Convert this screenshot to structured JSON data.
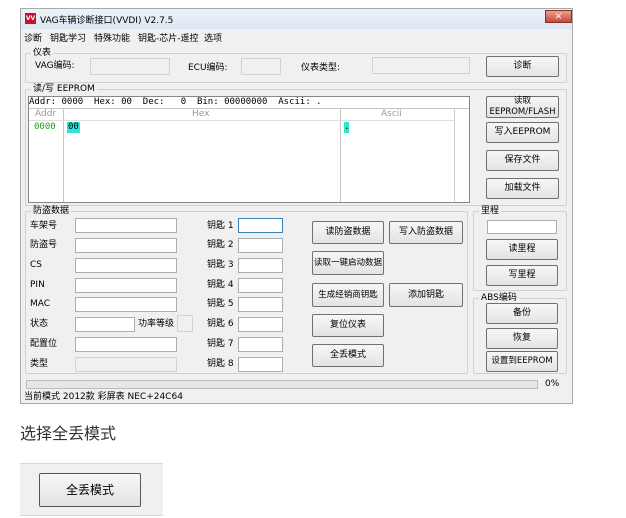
{
  "window": {
    "title": "VAG车辆诊断接口(VVDI)  V2.7.5",
    "logo_text": "VV",
    "close_glyph": "×"
  },
  "menu": [
    "诊断",
    "钥匙学习",
    "特殊功能",
    "钥匙-芯片-遥控",
    "选项"
  ],
  "instrument": {
    "group_label": "仪表",
    "vag_label": "VAG编码:",
    "ecu_label": "ECU编码:",
    "type_label": "仪表类型:",
    "diagnose_button": "诊断"
  },
  "eeprom": {
    "group_label": "读/写 EEPROM",
    "header_line": "Addr: 0000  Hex: 00  Dec:   0  Bin: 00000000  Ascii: .",
    "col_addr": "Addr",
    "col_hex": "Hex",
    "col_ascii": "Ascii",
    "row_addr": "0000",
    "row_hex": "00",
    "row_ascii": ".",
    "read_button": "读取\nEEPROM/FLASH",
    "write_button": "写入EEPROM",
    "save_button": "保存文件",
    "load_button": "加载文件"
  },
  "immo": {
    "group_label": "防盗数据",
    "fields": [
      "车架号",
      "防盗号",
      "CS",
      "PIN",
      "MAC",
      "状态",
      "配置位",
      "类型"
    ],
    "power_label": "功率等级",
    "keys": [
      "钥匙 1",
      "钥匙 2",
      "钥匙 3",
      "钥匙 4",
      "钥匙 5",
      "钥匙 6",
      "钥匙 7",
      "钥匙 8"
    ],
    "read_immo": "读防盗数据",
    "write_immo": "写入防盗数据",
    "read_start": "读取一键启动数据",
    "gen_dealer_key": "生成经销商钥匙",
    "add_key": "添加钥匙",
    "reset_cluster": "复位仪表",
    "all_keys_lost": "全丢模式"
  },
  "mileage": {
    "group_label": "里程",
    "read_button": "读里程",
    "write_button": "写里程"
  },
  "abs": {
    "group_label": "ABS编码",
    "backup_button": "备份",
    "restore_button": "恢复",
    "set_button": "设置到EEPROM"
  },
  "progress": {
    "percent_text": "0%",
    "value": 0
  },
  "status_text": "当前模式 2012款 彩屏表 NEC+24C64",
  "caption": "选择全丢模式",
  "zoom_button": "全丢模式"
}
